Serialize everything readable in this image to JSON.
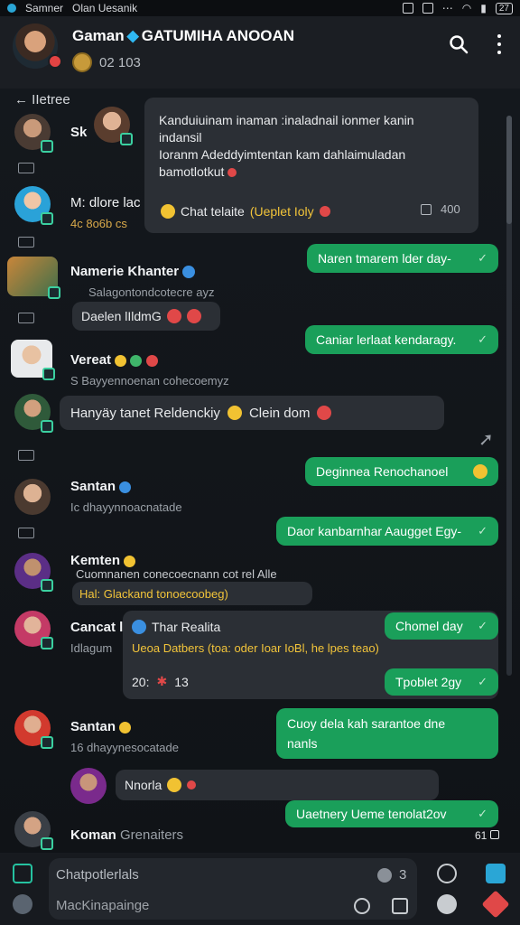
{
  "status_bar": {
    "carrier_left": "Samner",
    "carrier_center": "Olan Uesanik",
    "battery": "27"
  },
  "header": {
    "title_left": "Gaman",
    "title_right": "GATUMIHA ANOOAN",
    "subtitle": "02 103"
  },
  "chat": {
    "back_label": "IIetree",
    "messages": [
      {
        "type": "contact",
        "name": "Sk",
        "preview": ""
      },
      {
        "type": "card",
        "line1": "Kanduiuinam inaman :inaladnail ionmer kanin",
        "line2": "indansil",
        "line3": "Ioranm Adeddyimtentan kam dahlaimuladan",
        "line4": "bamotlotkut",
        "footer_label": "Chat telaite",
        "footer_highlight": "(Ueplet Ioly",
        "footer_count": "400"
      },
      {
        "type": "contact",
        "name": "M: dlore lac",
        "preview": "4c 8o6b cs"
      },
      {
        "type": "green",
        "text": "Naren tmarem lder day-"
      },
      {
        "type": "contact",
        "name": "Namerie Khanter",
        "preview": "Salagontondcotecre ayz"
      },
      {
        "type": "inline",
        "text": "Daelen lIldmG"
      },
      {
        "type": "green",
        "text": "Caniar lerlaat kendaragy."
      },
      {
        "type": "contact",
        "name": "Vereat",
        "preview": "S Bayyennoenan cohecoemyz"
      },
      {
        "type": "dark",
        "text": "Hanyäy tanet Reldenckiy",
        "extra": "Clein dom"
      },
      {
        "type": "green",
        "text": "Deginnea Renochanoel"
      },
      {
        "type": "contact",
        "name": "Santan",
        "preview": "Ic dhayynnoacnatade"
      },
      {
        "type": "green",
        "text": "Daor kanbarnhar Aaugget Egy-"
      },
      {
        "type": "contact",
        "name": "Kemten",
        "preview": "Cuomnanen conecoecnann cot rel Alle"
      },
      {
        "type": "inline",
        "text": "Hal: Glackand tonoecoobeg)"
      },
      {
        "type": "contact",
        "name": "Cancat l",
        "preview": "l\\ufeffatagum"
      },
      {
        "type": "card2",
        "title": "Thar Realita",
        "line": "Ueoa Datbers (toa: oder Ioar IoBl, he lpes teao)",
        "count_label": "20:",
        "count": "13"
      },
      {
        "type": "green",
        "text": "Chomel day"
      },
      {
        "type": "green",
        "text": "Tpoblet 2gy"
      },
      {
        "type": "contact",
        "name": "Santan",
        "preview": "16 dhayynesocatade"
      },
      {
        "type": "green",
        "text": "Cuoy dela kah sarantoe dne",
        "text2": "nanls"
      },
      {
        "type": "dark",
        "text": "Nnorla"
      },
      {
        "type": "green",
        "text": "Uaetnery Ueme tenolat2ov"
      },
      {
        "type": "contact",
        "name": "Koman",
        "preview": "Grenaiters"
      }
    ],
    "unread_badge": "61"
  },
  "footer": {
    "input_placeholder": "Chatpotlerlals",
    "input_count": "3",
    "second_line": "MacKinapainge"
  },
  "colors": {
    "accent_green": "#1a9f5a",
    "gem_blue": "#2fb8f2",
    "badge_red": "#e24343"
  },
  "icons": [
    "search-icon",
    "more-icon",
    "back-arrow-icon",
    "check-icon",
    "attach-icon",
    "emoji-icon",
    "clock-icon",
    "send-icon",
    "camera-icon"
  ]
}
